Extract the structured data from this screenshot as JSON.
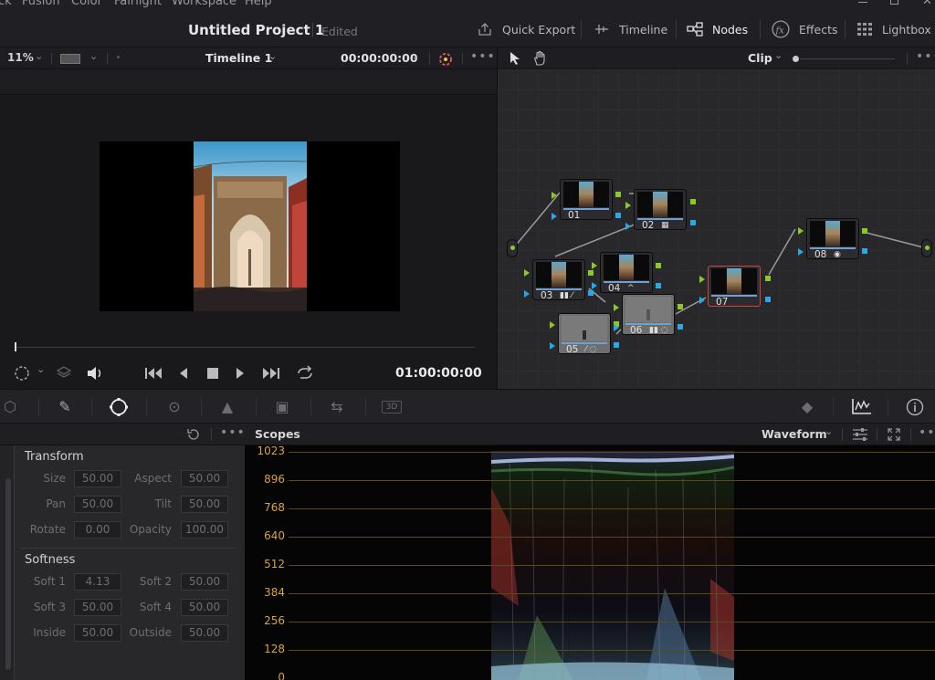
{
  "menu": [
    "ck",
    "Fusion",
    "Color",
    "Fairlight",
    "Workspace",
    "Help"
  ],
  "title": {
    "project": "Untitled Project 1",
    "status": "Edited"
  },
  "page_buttons": [
    {
      "label": "Quick Export",
      "icon": "export-icon"
    },
    {
      "label": "Timeline",
      "icon": "timeline-icon"
    },
    {
      "label": "Nodes",
      "icon": "nodes-icon"
    },
    {
      "label": "Effects",
      "icon": "fx-icon"
    },
    {
      "label": "Lightbox",
      "icon": "grid-icon"
    }
  ],
  "viewer": {
    "zoom": "11%",
    "timeline_name": "Timeline 1",
    "timecode": "00:00:00:00",
    "playhead_timecode": "01:00:00:00"
  },
  "node_editor": {
    "mode": "Clip",
    "nodes": [
      {
        "id": "01",
        "icons": ""
      },
      {
        "id": "02",
        "icons": "▦"
      },
      {
        "id": "03",
        "icons": "▮▮ ⁄"
      },
      {
        "id": "04",
        "icons": "^"
      },
      {
        "id": "05",
        "icons": "⁄ ◌"
      },
      {
        "id": "06",
        "icons": "▮▮ ◌"
      },
      {
        "id": "07",
        "icons": ""
      },
      {
        "id": "08",
        "icons": "◉"
      }
    ]
  },
  "window_panel": {
    "transform": {
      "title": "Transform",
      "size": {
        "label": "Size",
        "value": "50.00"
      },
      "aspect": {
        "label": "Aspect",
        "value": "50.00"
      },
      "pan": {
        "label": "Pan",
        "value": "50.00"
      },
      "tilt": {
        "label": "Tilt",
        "value": "50.00"
      },
      "rotate": {
        "label": "Rotate",
        "value": "0.00"
      },
      "opacity": {
        "label": "Opacity",
        "value": "100.00"
      }
    },
    "softness": {
      "title": "Softness",
      "soft1": {
        "label": "Soft 1",
        "value": "4.13"
      },
      "soft2": {
        "label": "Soft 2",
        "value": "50.00"
      },
      "soft3": {
        "label": "Soft 3",
        "value": "50.00"
      },
      "soft4": {
        "label": "Soft 4",
        "value": "50.00"
      },
      "inside": {
        "label": "Inside",
        "value": "50.00"
      },
      "outside": {
        "label": "Outside",
        "value": "50.00"
      }
    }
  },
  "scopes": {
    "title": "Scopes",
    "mode": "Waveform",
    "ticks": [
      "1023",
      "896",
      "768",
      "640",
      "512",
      "384",
      "256",
      "128",
      "0"
    ]
  },
  "colors": {
    "accent_green": "#8bc92a",
    "accent_blue": "#2aa7e8",
    "scope_tick": "#d7a43a",
    "selected_node": "#d0453a"
  }
}
